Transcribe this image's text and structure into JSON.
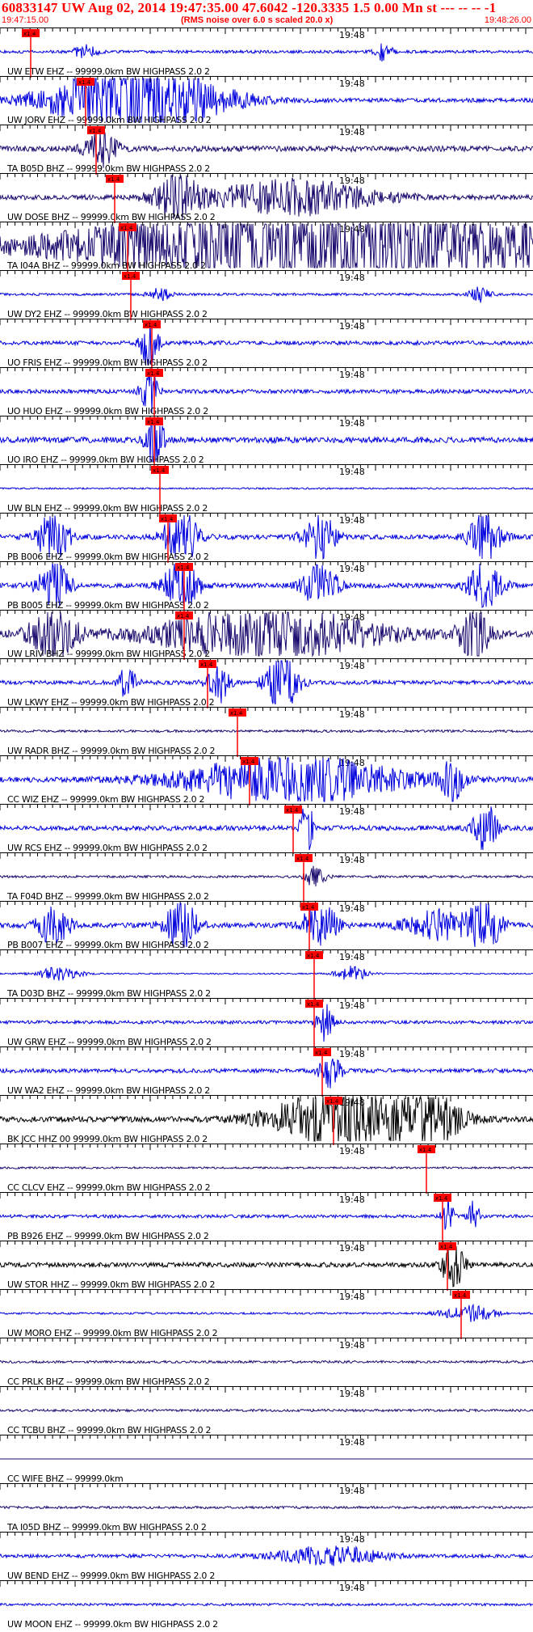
{
  "header": {
    "title": "60833147 UW Aug 02, 2014 19:47:35.00   47.6042 -120.3335  1.5 0.00 Mn st --- -- --   -1",
    "start_time": "19:47:15.00",
    "subtitle": "(RMS noise over 6.0 s scaled 20.0 x)",
    "end_time": "19:48:26.00"
  },
  "colors": {
    "header_text": "#ff0000",
    "pick_line": "#ff0000",
    "pick_flag": "#ff0000",
    "axis": "#000000",
    "trace_blue": "#0000dd",
    "trace_navy": "#1b0a6e",
    "trace_black": "#000000"
  },
  "time_mark_label": "19:48",
  "pick_flag_label": "x1.4",
  "traces": [
    {
      "label": "UW ETW  EHZ -- 99999.0km BW  HIGHPASS  2.0  2",
      "color": "trace_blue",
      "pick": 0.058,
      "amp": 0.18,
      "bursts": [
        [
          0.16,
          0.02,
          1.2
        ],
        [
          0.72,
          0.015,
          1.6
        ]
      ]
    },
    {
      "label": "UW JORV EHZ -- 99999.0km BW  HIGHPASS  2.0  2",
      "color": "trace_blue",
      "pick": 0.16,
      "amp": 0.25,
      "bursts": [
        [
          0.26,
          0.15,
          5.0
        ]
      ]
    },
    {
      "label": "TA B05D BHZ -- 99999.0km BW  HIGHPASS  2.0  2",
      "color": "trace_navy",
      "pick": 0.18,
      "amp": 0.35,
      "bursts": [
        [
          0.19,
          0.03,
          1.5
        ]
      ]
    },
    {
      "label": "UW DOSE BHZ -- 99999.0km BW  HIGHPASS  2.0  2",
      "color": "trace_navy",
      "pick": 0.215,
      "amp": 0.3,
      "bursts": [
        [
          0.33,
          0.04,
          2.5
        ],
        [
          0.55,
          0.15,
          1.8
        ]
      ]
    },
    {
      "label": "TA I04A BHZ -- 99999.0km BW  HIGHPASS  2.0  2",
      "color": "trace_navy",
      "pick": 0.24,
      "amp": 0.6,
      "bursts": [
        [
          0.6,
          0.4,
          2.3
        ]
      ]
    },
    {
      "label": "UW DY2  EHZ -- 99999.0km BW  HIGHPASS  2.0  2",
      "color": "trace_blue",
      "pick": 0.245,
      "amp": 0.15,
      "bursts": [
        [
          0.3,
          0.02,
          1.5
        ],
        [
          0.9,
          0.02,
          1.5
        ]
      ]
    },
    {
      "label": "UO FRIS EHZ -- 99999.0km BW  HIGHPASS  2.0  2",
      "color": "trace_blue",
      "pick": 0.285,
      "amp": 0.25,
      "bursts": [
        [
          0.28,
          0.015,
          3.5
        ]
      ]
    },
    {
      "label": "UO HUO  EHZ -- 99999.0km BW  HIGHPASS  2.0  2",
      "color": "trace_blue",
      "pick": 0.29,
      "amp": 0.25,
      "bursts": [
        [
          0.28,
          0.015,
          3.0
        ]
      ]
    },
    {
      "label": "UO IRO  EHZ -- 99999.0km BW  HIGHPASS  2.0  2",
      "color": "trace_blue",
      "pick": 0.29,
      "amp": 0.35,
      "bursts": [
        [
          0.29,
          0.015,
          3.5
        ]
      ]
    },
    {
      "label": "UW BLN  EHZ -- 99999.0km BW  HIGHPASS  2.0  2",
      "color": "trace_blue",
      "pick": 0.3,
      "amp": 0.1,
      "bursts": []
    },
    {
      "label": "PB B006 EHZ -- 99999.0km BW  HIGHPASS  2.0  2",
      "color": "trace_blue",
      "pick": 0.315,
      "amp": 0.3,
      "bursts": [
        [
          0.1,
          0.03,
          2.5
        ],
        [
          0.34,
          0.03,
          3.0
        ],
        [
          0.6,
          0.03,
          2.5
        ],
        [
          0.91,
          0.03,
          2.5
        ]
      ]
    },
    {
      "label": "PB B005 EHZ -- 99999.0km BW  HIGHPASS  2.0  2",
      "color": "trace_blue",
      "pick": 0.345,
      "amp": 0.3,
      "bursts": [
        [
          0.1,
          0.03,
          2.3
        ],
        [
          0.34,
          0.03,
          3.0
        ],
        [
          0.6,
          0.03,
          2.5
        ],
        [
          0.91,
          0.03,
          2.5
        ]
      ]
    },
    {
      "label": "UW LRIV BHZ -- 99999.0km BW  HIGHPASS  2.0  2",
      "color": "trace_navy",
      "pick": 0.345,
      "amp": 0.4,
      "bursts": [
        [
          0.1,
          0.04,
          2.5
        ],
        [
          0.5,
          0.2,
          2.0
        ],
        [
          0.89,
          0.03,
          2.0
        ]
      ]
    },
    {
      "label": "UW LKWY EHZ -- 99999.0km BW  HIGHPASS  2.0  2",
      "color": "trace_blue",
      "pick": 0.39,
      "amp": 0.25,
      "bursts": [
        [
          0.24,
          0.015,
          2.5
        ],
        [
          0.41,
          0.02,
          2.5
        ],
        [
          0.53,
          0.03,
          3.5
        ]
      ]
    },
    {
      "label": "UW RADR BHZ -- 99999.0km BW  HIGHPASS  2.0  2",
      "color": "trace_navy",
      "pick": 0.445,
      "amp": 0.15,
      "bursts": []
    },
    {
      "label": "CC WIZ  EHZ -- 99999.0km BW  HIGHPASS  2.0  2",
      "color": "trace_blue",
      "pick": 0.468,
      "amp": 0.3,
      "bursts": [
        [
          0.55,
          0.2,
          2.5
        ],
        [
          0.85,
          0.02,
          2.0
        ]
      ]
    },
    {
      "label": "UW RCS  EHZ -- 99999.0km BW  HIGHPASS  2.0  2",
      "color": "trace_blue",
      "pick": 0.55,
      "amp": 0.3,
      "bursts": [
        [
          0.575,
          0.01,
          4.0
        ],
        [
          0.91,
          0.02,
          3.0
        ]
      ]
    },
    {
      "label": "TA F04D BHZ -- 99999.0km BW  HIGHPASS  2.0  2",
      "color": "trace_navy",
      "pick": 0.57,
      "amp": 0.15,
      "bursts": [
        [
          0.59,
          0.02,
          2.0
        ]
      ]
    },
    {
      "label": "PB B007 EHZ -- 99999.0km BW  HIGHPASS  2.0  2",
      "color": "trace_blue",
      "pick": 0.58,
      "amp": 0.3,
      "bursts": [
        [
          0.1,
          0.03,
          2.0
        ],
        [
          0.34,
          0.03,
          2.5
        ],
        [
          0.6,
          0.03,
          2.5
        ],
        [
          0.91,
          0.03,
          2.5
        ],
        [
          0.82,
          0.06,
          1.5
        ]
      ]
    },
    {
      "label": "TA D03D BHZ -- 99999.0km BW  HIGHPASS  2.0  2",
      "color": "trace_blue",
      "pick": 0.59,
      "amp": 0.08,
      "bursts": [
        [
          0.11,
          0.04,
          2.5
        ],
        [
          0.66,
          0.03,
          3.0
        ]
      ]
    },
    {
      "label": "UW GRW  EHZ -- 99999.0km BW  HIGHPASS  2.0  2",
      "color": "trace_blue",
      "pick": 0.59,
      "amp": 0.2,
      "bursts": [
        [
          0.61,
          0.015,
          3.0
        ]
      ]
    },
    {
      "label": "UW WA2  EHZ -- 99999.0km BW  HIGHPASS  2.0  2",
      "color": "trace_blue",
      "pick": 0.605,
      "amp": 0.25,
      "bursts": [
        [
          0.62,
          0.02,
          2.0
        ]
      ]
    },
    {
      "label": "BK JCC  HHZ 00 99999.0km BW  HIGHPASS  2.0  2",
      "color": "trace_black",
      "pick": 0.625,
      "amp": 0.35,
      "bursts": [
        [
          0.64,
          0.12,
          2.8
        ],
        [
          0.8,
          0.06,
          2.5
        ]
      ]
    },
    {
      "label": "CC CLCV EHZ -- 99999.0km BW  HIGHPASS  2.0  2",
      "color": "trace_navy",
      "pick": 0.8,
      "amp": 0.12,
      "bursts": []
    },
    {
      "label": "PB B926 EHZ -- 99999.0km BW  HIGHPASS  2.0  2",
      "color": "trace_blue",
      "pick": 0.83,
      "amp": 0.2,
      "bursts": [
        [
          0.84,
          0.01,
          3.0
        ],
        [
          0.89,
          0.01,
          3.0
        ]
      ]
    },
    {
      "label": "UW STOR HHZ -- 99999.0km BW  HIGHPASS  2.0  2",
      "color": "trace_black",
      "pick": 0.84,
      "amp": 0.3,
      "bursts": [
        [
          0.85,
          0.02,
          2.5
        ]
      ]
    },
    {
      "label": "UW MORO EHZ -- 99999.0km BW  HIGHPASS  2.0  2",
      "color": "trace_blue",
      "pick": 0.865,
      "amp": 0.12,
      "bursts": [
        [
          0.88,
          0.05,
          2.0
        ]
      ]
    },
    {
      "label": "CC PRLK BHZ -- 99999.0km BW  HIGHPASS  2.0  2",
      "color": "trace_navy",
      "pick": null,
      "amp": 0.15,
      "bursts": []
    },
    {
      "label": "CC TCBU BHZ -- 99999.0km BW  HIGHPASS  2.0  2",
      "color": "trace_navy",
      "pick": null,
      "amp": 0.15,
      "bursts": []
    },
    {
      "label": "CC WIFE BHZ -- 99999.0km",
      "color": "trace_navy",
      "pick": null,
      "amp": 0.0,
      "bursts": []
    },
    {
      "label": "TA I05D BHZ -- 99999.0km BW  HIGHPASS  2.0  2",
      "color": "trace_navy",
      "pick": null,
      "amp": 0.15,
      "bursts": []
    },
    {
      "label": "UW BEND EHZ -- 99999.0km BW  HIGHPASS  2.0  2",
      "color": "trace_blue",
      "pick": null,
      "amp": 0.22,
      "bursts": [
        [
          0.62,
          0.1,
          1.3
        ]
      ]
    },
    {
      "label": "UW MOON EHZ -- 99999.0km BW  HIGHPASS  2.0  2",
      "color": "trace_blue",
      "pick": null,
      "amp": 0.15,
      "bursts": []
    }
  ]
}
